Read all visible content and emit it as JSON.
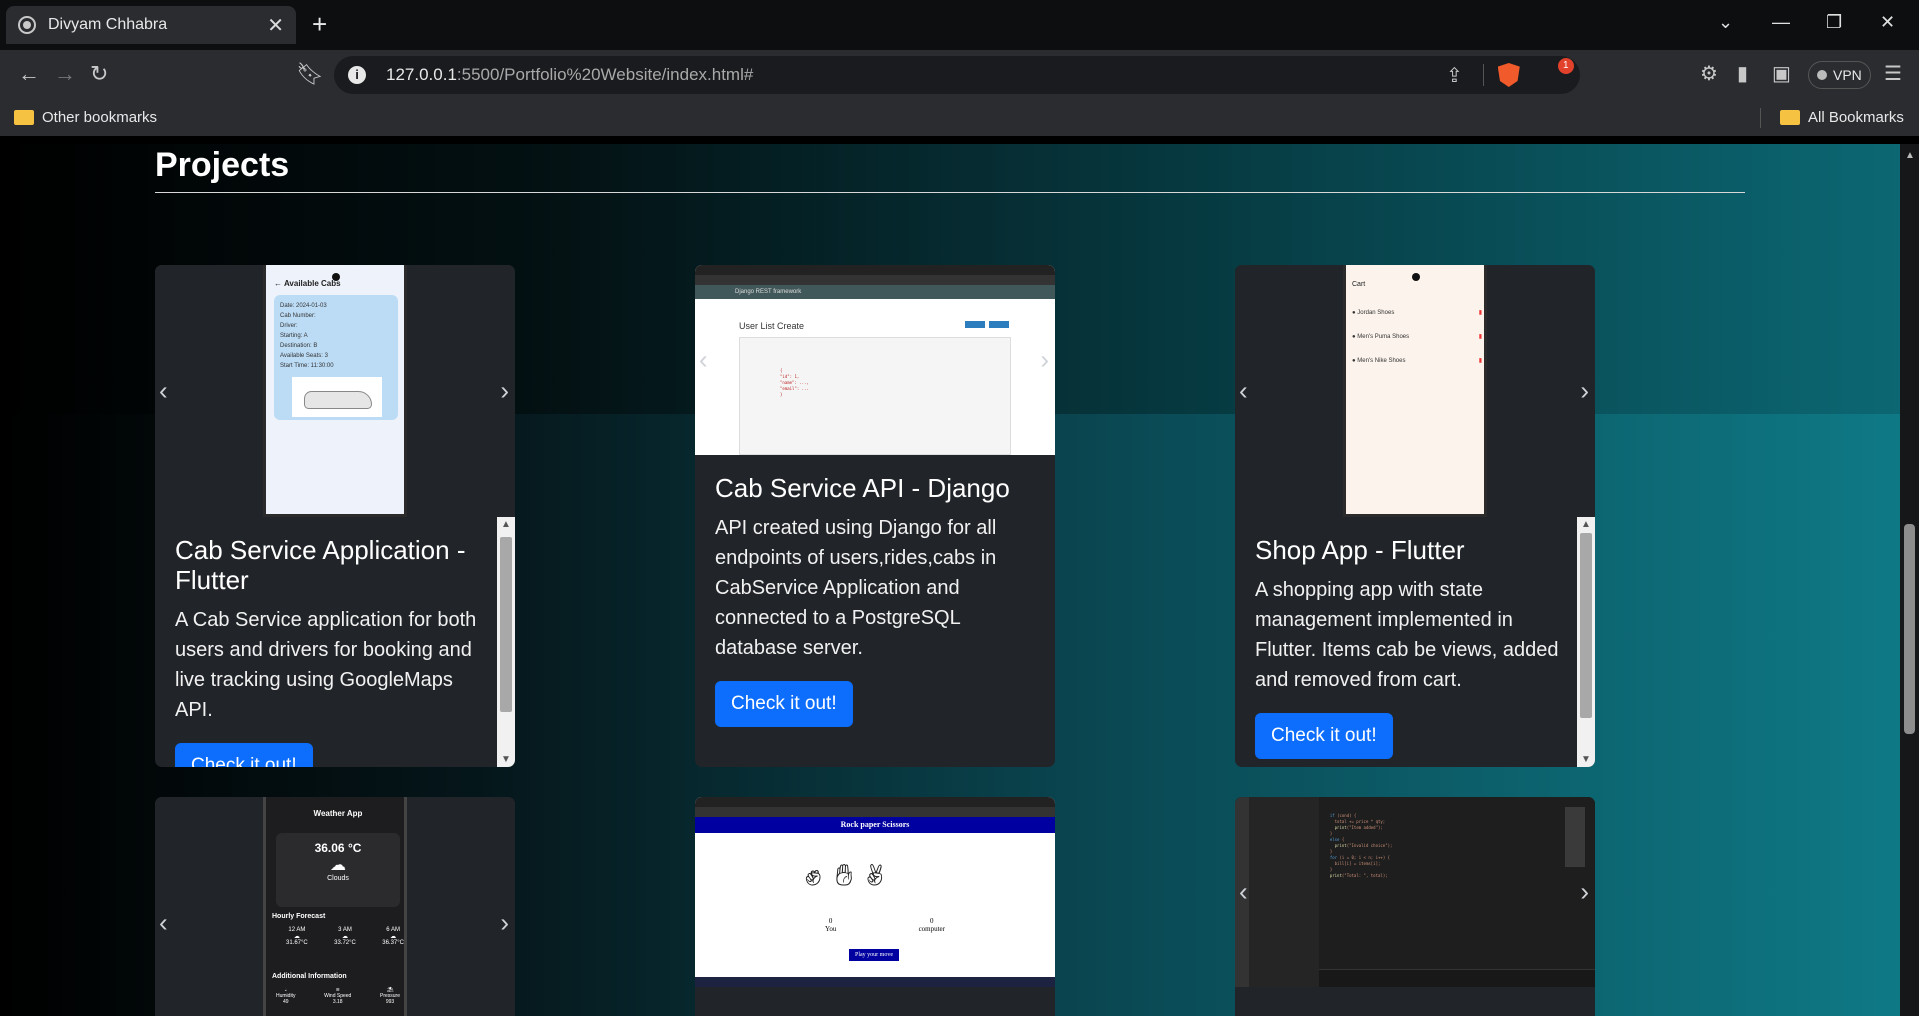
{
  "browser": {
    "tab_title": "Divyam Chhabra",
    "new_tab": "+",
    "close_tab": "✕",
    "url_host": "127.0.0.1",
    "url_rest": ":5500/Portfolio%20Website/index.html#",
    "vpn_label": "VPN",
    "rewards_badge": "1",
    "bookmarks": {
      "left": "Other bookmarks",
      "right": "All Bookmarks"
    }
  },
  "section": {
    "title": "Projects"
  },
  "projects": [
    {
      "title": "Cab Service Application - Flutter",
      "description": "A Cab Service application for both users and drivers for booking and live tracking using GoogleMaps API.",
      "button": "Check it out!",
      "screenshot": {
        "app_title": "Available Cabs",
        "lines": [
          "Date: 2024-01-03",
          "Cab Number:",
          "Driver:",
          "Starting: A",
          "Destination: B",
          "Available Seats: 3",
          "Start Time: 11:30:00"
        ]
      }
    },
    {
      "title": "Cab Service API - Django",
      "description": "API created using Django for all endpoints of users,rides,cabs in CabService Application and connected to a PostgreSQL database server.",
      "button": "Check it out!",
      "screenshot": {
        "framework": "Django REST framework",
        "heading": "User List Create"
      }
    },
    {
      "title": "Shop App - Flutter",
      "description": "A shopping app with state management implemented in Flutter. Items cab be views, added and removed from cart.",
      "button": "Check it out!",
      "screenshot": {
        "app_title": "Cart",
        "items": [
          "Jordan Shoes",
          "Men's Puma Shoes",
          "Men's Nike Shoes"
        ]
      }
    },
    {
      "title": "",
      "screenshot": {
        "app_title": "Weather App",
        "temperature": "36.06 °C",
        "condition": "Clouds",
        "hourly_label": "Hourly Forecast",
        "hours": [
          "12 AM",
          "3 AM",
          "6 AM"
        ],
        "temps": [
          "31.67°C",
          "33.72°C",
          "36.37°C"
        ],
        "additional_label": "Additional Information",
        "info_labels": [
          "Humidity",
          "Wind Speed",
          "Pressure"
        ],
        "info_values": [
          "49",
          "3.18",
          "993"
        ]
      }
    },
    {
      "title": "",
      "screenshot": {
        "game_title": "Rock paper Scissors",
        "score_you": "0",
        "score_computer": "0",
        "label_you": "You",
        "label_computer": "computer",
        "play_button": "Play your move"
      }
    },
    {
      "title": "",
      "screenshot": {
        "kind": "code editor"
      }
    }
  ]
}
